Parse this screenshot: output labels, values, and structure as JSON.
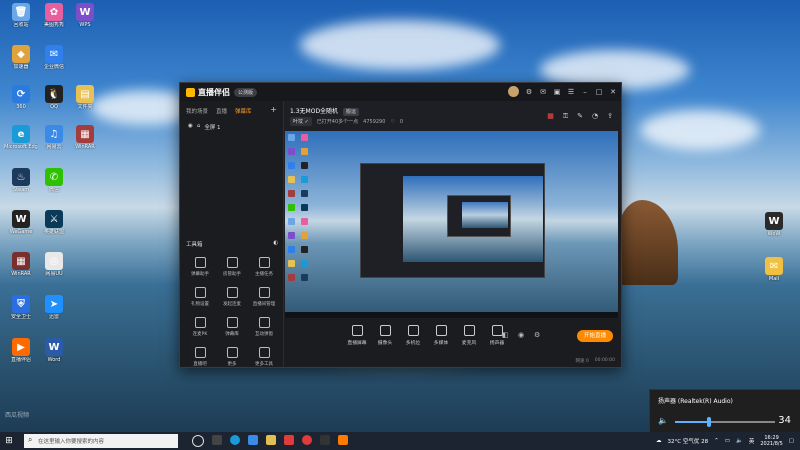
{
  "app": {
    "name": "直播伴侣",
    "version_badge": "公测版",
    "tabs": [
      "我的场景",
      "直播",
      "弹幕库"
    ],
    "scene_label": "全屏 1",
    "tools_header": "工具箱",
    "tools": [
      "弹幕助手",
      "房管助手",
      "主播任务",
      "礼物设置",
      "发起连麦",
      "直播间管理",
      "连麦PK",
      "弹幕库",
      "互动弹窗",
      "直播吧",
      "更多",
      "更多工具"
    ],
    "stream_title": "1.3无MOD全随机",
    "stream_tag": "搬运",
    "category_chip": "叶坟 ✓",
    "sub_text": "已打开40多个一点",
    "viewer_count": "4759290",
    "likes": "0",
    "controls": [
      "直播屏幕",
      "摄像头",
      "多机位",
      "多媒体",
      "麦克风",
      "扬声器"
    ],
    "start_button": "开始直播",
    "status": [
      "网速 0",
      "00:00:00"
    ]
  },
  "desktop_icons": [
    {
      "label": "回收站",
      "color": "#6aa6e8",
      "glyph": "🗑"
    },
    {
      "label": "美图秀秀",
      "color": "#e85fa0",
      "glyph": "✿"
    },
    {
      "label": "WPS",
      "color": "#7b4fc9",
      "glyph": "W"
    },
    {
      "label": "加速器",
      "color": "#e0a23a",
      "glyph": "◆"
    },
    {
      "label": "企业微信",
      "color": "#2f80ed",
      "glyph": "✉"
    },
    {
      "label": "360",
      "color": "#2a7be0",
      "glyph": "⟳"
    },
    {
      "label": "QQ",
      "color": "#222",
      "glyph": "🐧"
    },
    {
      "label": "文件夹",
      "color": "#e8c155",
      "glyph": "▤"
    },
    {
      "label": "Microsoft Edge",
      "color": "#1a9ad6",
      "glyph": "e"
    },
    {
      "label": "网易云",
      "color": "#3a8ae8",
      "glyph": "♫"
    },
    {
      "label": "WinRAR",
      "color": "#a33c3c",
      "glyph": "▦"
    },
    {
      "label": "Steam",
      "color": "#1b3a5c",
      "glyph": "♨"
    },
    {
      "label": "微信",
      "color": "#2dc100",
      "glyph": "✆"
    },
    {
      "label": "WeGame",
      "color": "#222",
      "glyph": "W"
    },
    {
      "label": "英雄联盟",
      "color": "#0a3a58",
      "glyph": "⚔"
    },
    {
      "label": "WinRAR",
      "color": "#7a2f2f",
      "glyph": "▦"
    },
    {
      "label": "网易UU",
      "color": "#e8e8e8",
      "glyph": "◎"
    },
    {
      "label": "安全卫士",
      "color": "#2a6ee0",
      "glyph": "⛨"
    },
    {
      "label": "迅雷",
      "color": "#1e90ff",
      "glyph": "➤"
    },
    {
      "label": "直播伴侣",
      "color": "#ff6a00",
      "glyph": "▶"
    },
    {
      "label": "Word",
      "color": "#2b5aa8",
      "glyph": "W"
    }
  ],
  "right_icons": [
    {
      "label": "WoW",
      "color": "#2a2a2a",
      "glyph": "W"
    },
    {
      "label": "Mail",
      "color": "#f0c040",
      "glyph": "✉"
    }
  ],
  "volume": {
    "device": "扬声器 (Realtek(R) Audio)",
    "level": 34
  },
  "taskbar": {
    "search_placeholder": "在这里输入你要搜索的内容",
    "weather": "32°C 空气优 28",
    "ime": "英",
    "time": "16:29",
    "date": "2021/8/5"
  },
  "watermark": "西瓜视频"
}
